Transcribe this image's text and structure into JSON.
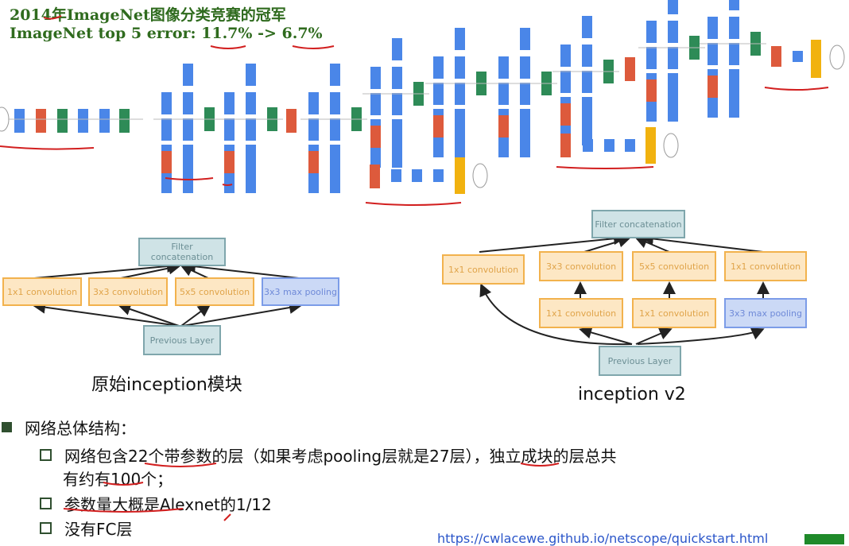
{
  "title": {
    "line1": "2014年ImageNet图像分类竞赛的冠军",
    "line2": "ImageNet top 5 error: 11.7% -> 6.7%"
  },
  "inception_original": {
    "filter": "Filter concatenation",
    "branches": [
      "1x1 convolution",
      "3x3 convolution",
      "5x5 convolution",
      "3x3 max pooling"
    ],
    "previous": "Previous Layer",
    "caption": "原始inception模块"
  },
  "inception_v2": {
    "filter": "Filter concatenation",
    "top_row": [
      "1x1 convolution",
      "3x3 convolution",
      "5x5 convolution",
      "1x1 convolution"
    ],
    "second_row": [
      "1x1 convolution",
      "1x1 convolution",
      "3x3 max pooling"
    ],
    "previous": "Previous Layer",
    "caption": "inception v2"
  },
  "bullets": {
    "heading": "网络总体结构：",
    "items": [
      "网络包含22个带参数的层（如果考虑pooling层就是27层），独立成块的层总共",
      "有约有100个；",
      "参数量大概是Alexnet的1/12",
      "没有FC层"
    ]
  },
  "link": "https://cwlacewe.github.io/netscope/quickstart.html",
  "colors": {
    "conv": "#4a86e8",
    "pool_red": "#dd5a3c",
    "concat_green": "#2e8b57",
    "softmax_yellow": "#f1b20f",
    "title_green": "#2f6b1e",
    "annotation_red": "#d21f1f"
  }
}
